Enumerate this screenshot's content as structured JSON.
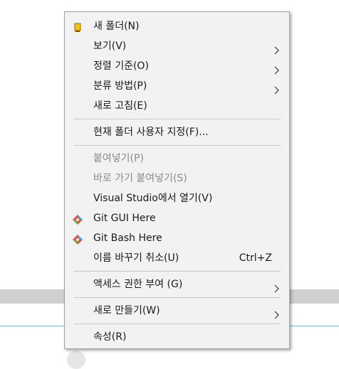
{
  "menu": {
    "items": [
      {
        "label": "새 폴더(N)",
        "icon": "folder-icon"
      },
      {
        "label": "보기(V)",
        "submenu": true
      },
      {
        "label": "정렬 기준(O)",
        "submenu": true
      },
      {
        "label": "분류 방법(P)",
        "submenu": true
      },
      {
        "label": "새로 고침(E)"
      },
      {
        "label": "현재 폴더 사용자 지정(F)..."
      },
      {
        "label": "붙여넣기(P)",
        "disabled": true
      },
      {
        "label": "바로 가기 붙여넣기(S)",
        "disabled": true
      },
      {
        "label": "Visual Studio에서 열기(V)"
      },
      {
        "label": "Git GUI Here",
        "icon": "git-gui-icon"
      },
      {
        "label": "Git Bash Here",
        "icon": "git-bash-icon"
      },
      {
        "label": "이름 바꾸기 취소(U)",
        "shortcut": "Ctrl+Z"
      },
      {
        "label": "액세스 권한 부여 (G)",
        "submenu": true
      },
      {
        "label": "새로 만들기(W)",
        "submenu": true
      },
      {
        "label": "속성(R)"
      }
    ]
  },
  "colors": {
    "menu_background": "#f2f2f2",
    "text": "#1a1a1a",
    "disabled_text": "#8a8a8a",
    "separator": "#c8c8c8"
  }
}
